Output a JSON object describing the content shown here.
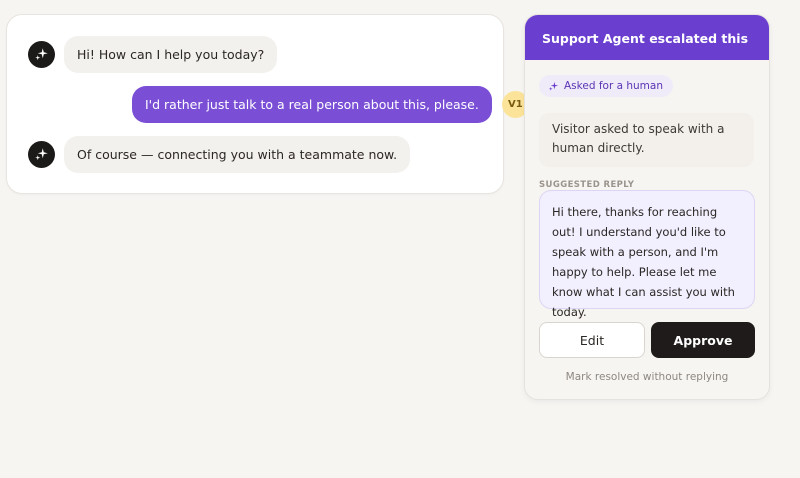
{
  "chat": {
    "messages": [
      {
        "role": "bot",
        "text": "Hi! How can I help you today?"
      },
      {
        "role": "user",
        "text": "I'd rather just talk to a real person about this, please.",
        "avatar_initials": "V1"
      },
      {
        "role": "bot",
        "text": "Of course — connecting you with a teammate now."
      }
    ]
  },
  "panel": {
    "title": "Support Agent escalated this",
    "tag_label": "Asked for a human",
    "reason": "Visitor asked to speak with a human directly.",
    "suggested_label": "SUGGESTED REPLY",
    "suggested_reply": "Hi there, thanks for reaching out! I understand you'd like to speak with a person, and I'm happy to help. Please let me know what I can assist you with today.",
    "edit_label": "Edit",
    "approve_label": "Approve",
    "resolve_label": "Mark resolved without replying"
  },
  "colors": {
    "accent": "#6a3fd0",
    "user_bubble": "#7a4fd6",
    "user_avatar": "#fbe49a",
    "bot_avatar": "#1c1a19"
  },
  "icons": {
    "bot_avatar": "sparkle-icon",
    "tag": "sparkle-icon"
  }
}
